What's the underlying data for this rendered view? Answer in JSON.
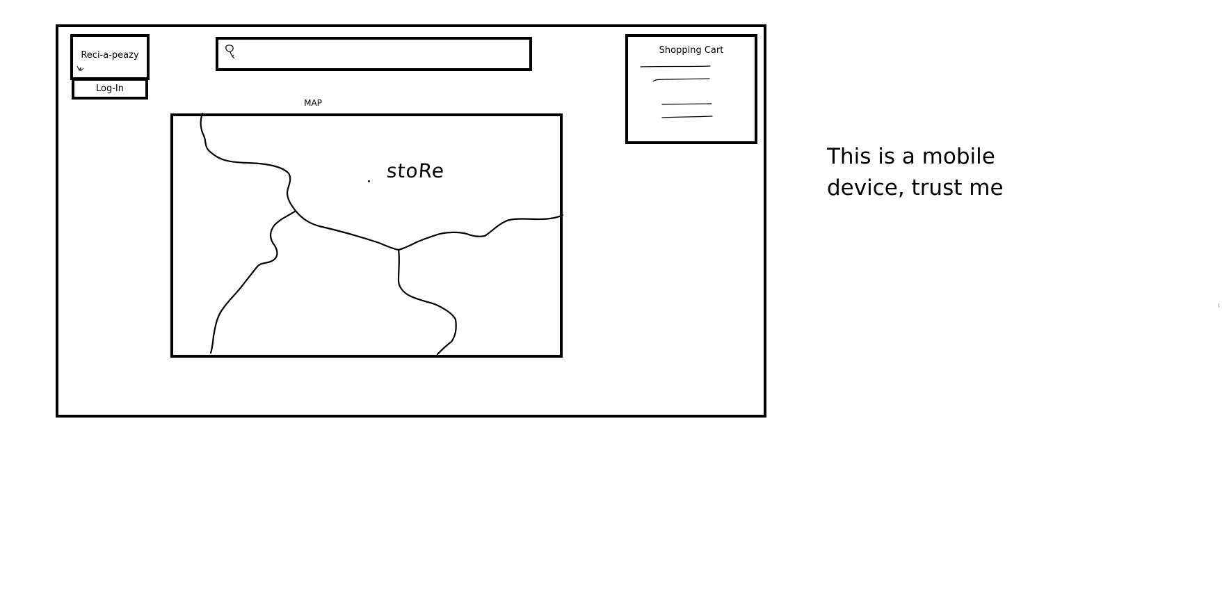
{
  "app": {
    "logo_text": "Reci-a-peazy",
    "login_label": "Log-In"
  },
  "search": {
    "value": "",
    "placeholder": "",
    "icon": "search-icon"
  },
  "map": {
    "label": "MAP",
    "store_label": "stoRe"
  },
  "cart": {
    "title": "Shopping Cart",
    "item_count_lines": 4
  },
  "note": {
    "text": "This is a mobile device, trust me"
  },
  "colors": {
    "ink": "#000000",
    "background": "#ffffff"
  }
}
